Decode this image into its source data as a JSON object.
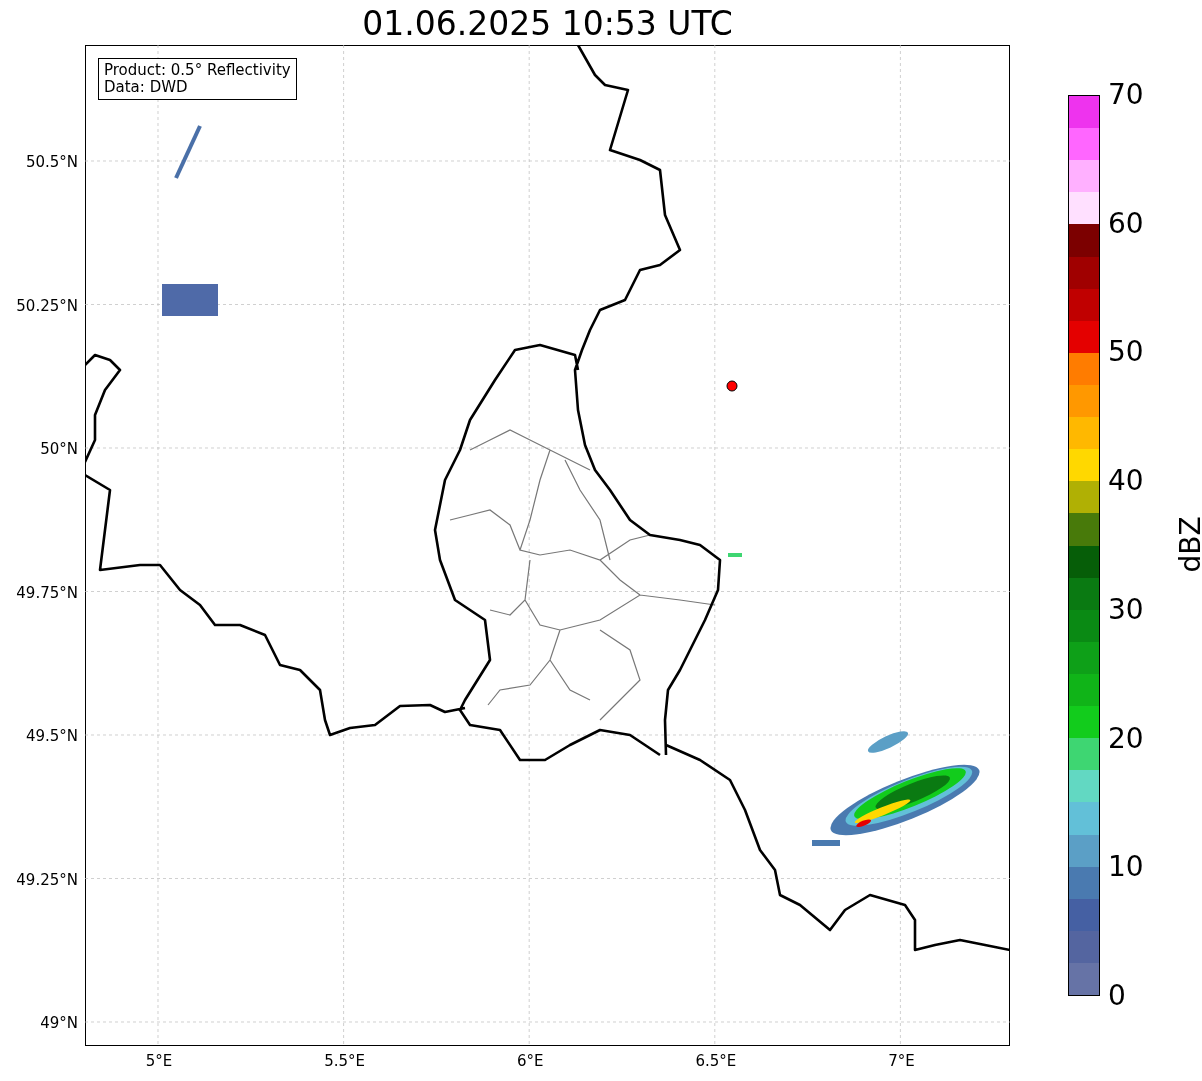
{
  "title": "01.06.2025 10:53 UTC",
  "info_box": [
    "Product: 0.5° Reflectivity",
    "Data: DWD"
  ],
  "map": {
    "x_ticks": [
      "5°E",
      "5.5°E",
      "6°E",
      "6.5°E",
      "7°E"
    ],
    "y_ticks": [
      "50.5°N",
      "50.25°N",
      "50°N",
      "49.75°N",
      "49.5°N",
      "49.25°N",
      "49°N"
    ]
  },
  "colorbar": {
    "label": "dBZ",
    "ticks": [
      "70",
      "60",
      "50",
      "40",
      "30",
      "20",
      "10",
      "0"
    ],
    "bands": [
      {
        "color": "#ee33ee"
      },
      {
        "color": "#ff66ff"
      },
      {
        "color": "#ffb0ff"
      },
      {
        "color": "#ffe0ff"
      },
      {
        "color": "#7c0000"
      },
      {
        "color": "#a00000"
      },
      {
        "color": "#c00000"
      },
      {
        "color": "#e40000"
      },
      {
        "color": "#ff7c00"
      },
      {
        "color": "#ff9800"
      },
      {
        "color": "#ffb800"
      },
      {
        "color": "#ffd800"
      },
      {
        "color": "#b0b004"
      },
      {
        "color": "#487a0a"
      },
      {
        "color": "#065e08"
      },
      {
        "color": "#0a7a12"
      },
      {
        "color": "#0a8a14"
      },
      {
        "color": "#0ea018"
      },
      {
        "color": "#10b418"
      },
      {
        "color": "#12cc1c"
      },
      {
        "color": "#3ed672"
      },
      {
        "color": "#62d8c2"
      },
      {
        "color": "#62c0d8"
      },
      {
        "color": "#5b9fc6"
      },
      {
        "color": "#4a7ab0"
      },
      {
        "color": "#4560a3"
      },
      {
        "color": "#5465a0"
      },
      {
        "color": "#6673a6"
      }
    ]
  }
}
